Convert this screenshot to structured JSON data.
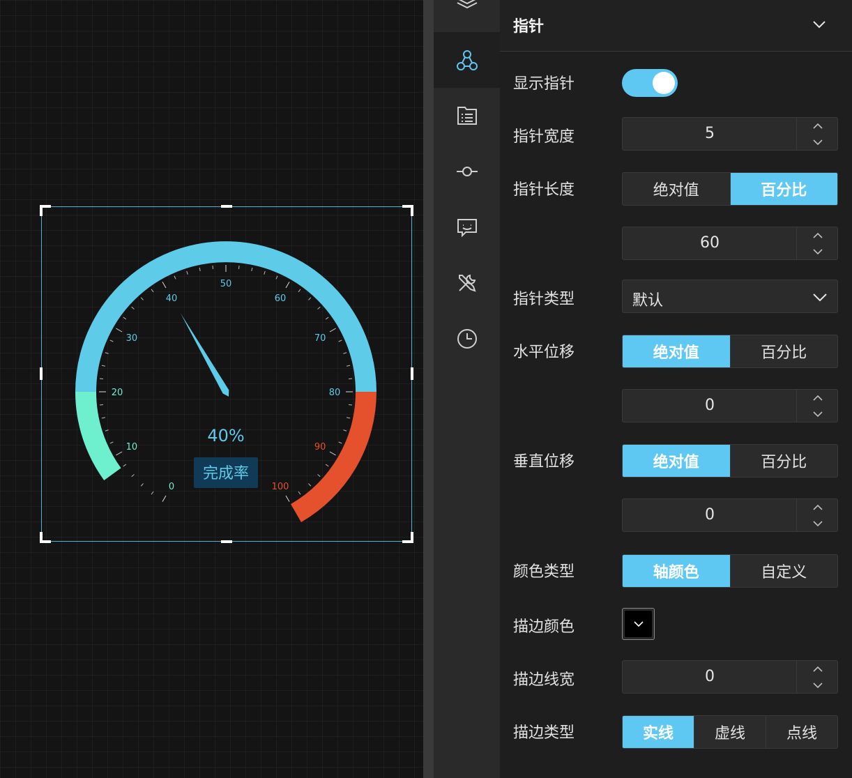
{
  "gauge": {
    "min": 0,
    "max": 100,
    "value": 40,
    "value_text": "40%",
    "caption": "完成率",
    "tick_labels": [
      "0",
      "10",
      "20",
      "30",
      "40",
      "50",
      "60",
      "70",
      "80",
      "90",
      "100"
    ],
    "segments": [
      {
        "from": 0,
        "to": 20,
        "color": "#6ef0cf"
      },
      {
        "from": 20,
        "to": 80,
        "color": "#5ecbe8"
      },
      {
        "from": 80,
        "to": 100,
        "color": "#e5512d"
      }
    ],
    "pointer_color": "#5ecbe8"
  },
  "sidebar_icons": [
    "layers-icon",
    "nodes-icon",
    "list-icon",
    "connector-icon",
    "comment-icon",
    "tools-icon",
    "clock-icon"
  ],
  "panel": {
    "title": "指针",
    "show_pointer": {
      "label": "显示指针",
      "on": true
    },
    "pointer_width": {
      "label": "指针宽度",
      "value": "5"
    },
    "pointer_length": {
      "label": "指针长度",
      "options": [
        "绝对值",
        "百分比"
      ],
      "selected": "百分比",
      "value": "60"
    },
    "pointer_type": {
      "label": "指针类型",
      "value": "默认"
    },
    "h_offset": {
      "label": "水平位移",
      "options": [
        "绝对值",
        "百分比"
      ],
      "selected": "绝对值",
      "value": "0"
    },
    "v_offset": {
      "label": "垂直位移",
      "options": [
        "绝对值",
        "百分比"
      ],
      "selected": "绝对值",
      "value": "0"
    },
    "color_type": {
      "label": "颜色类型",
      "options": [
        "轴颜色",
        "自定义"
      ],
      "selected": "轴颜色"
    },
    "stroke_color": {
      "label": "描边颜色",
      "color": "#000000"
    },
    "stroke_width": {
      "label": "描边线宽",
      "value": "0"
    },
    "stroke_type": {
      "label": "描边类型",
      "options": [
        "实线",
        "虚线",
        "点线"
      ],
      "selected": "实线"
    }
  },
  "colors": {
    "accent": "#5ec8f2"
  }
}
